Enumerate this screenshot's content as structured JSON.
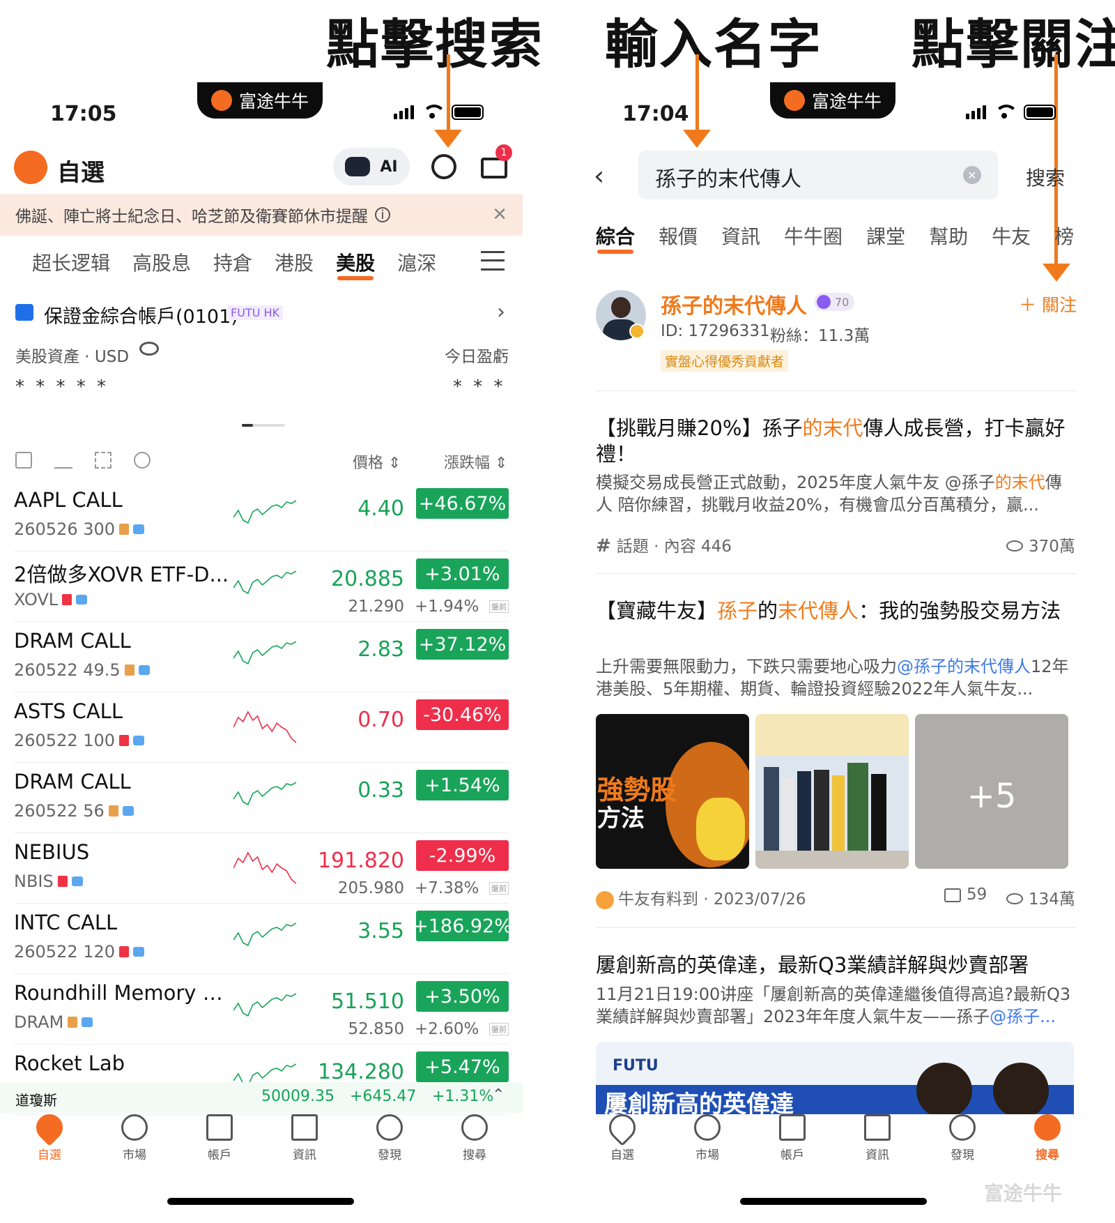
{
  "annotations": {
    "left_top": "點擊搜索",
    "right_middle": "輸入名字",
    "right_top": "點擊關注"
  },
  "left": {
    "pill": "富途牛牛",
    "time": "17:05",
    "title": "自選",
    "ai_label": "AI",
    "mail_badge": "1",
    "banner": "佛誕、陣亡將士紀念日、哈芝節及衛賽節休市提醒",
    "tabs": [
      "超长逻辑",
      "高股息",
      "持倉",
      "港股",
      "美股",
      "滬深"
    ],
    "active_tab": "美股",
    "account": {
      "name": "保證金綜合帳戶(0101)",
      "badge": "FUTU HK",
      "assets_label": "美股資產 · USD",
      "today_pl_label": "今日盈虧",
      "assets_masked": "* * * * *",
      "pl_masked": "* * *"
    },
    "columns": {
      "price": "價格",
      "change": "漲跌幅"
    },
    "stocks": [
      {
        "name": "AAPL CALL",
        "code": "260526 300",
        "price": "4.40",
        "change": "+46.67%",
        "dir": "up",
        "doc": "#e8a04a"
      },
      {
        "name": "2倍做多XOVR ETF-D...",
        "code": "XOVL",
        "price": "20.885",
        "change": "+3.01%",
        "dir": "up",
        "doc": "#ee3344",
        "pre_price": "21.290",
        "pre_change": "+1.94%",
        "pre_tag": "盤前"
      },
      {
        "name": "DRAM CALL",
        "code": "260522 49.5",
        "price": "2.83",
        "change": "+37.12%",
        "dir": "up",
        "doc": "#e8a04a"
      },
      {
        "name": "ASTS CALL",
        "code": "260522 100",
        "price": "0.70",
        "change": "-30.46%",
        "dir": "down",
        "doc": "#ee3344"
      },
      {
        "name": "DRAM CALL",
        "code": "260522 56",
        "price": "0.33",
        "change": "+1.54%",
        "dir": "up",
        "doc": "#e8a04a"
      },
      {
        "name": "NEBIUS",
        "code": "NBIS",
        "price": "191.820",
        "change": "-2.99%",
        "dir": "down",
        "doc": "#ee3344",
        "pre_price": "205.980",
        "pre_change": "+7.38%",
        "pre_tag": "盤前"
      },
      {
        "name": "INTC CALL",
        "code": "260522 120",
        "price": "3.55",
        "change": "+186.92%",
        "dir": "up",
        "doc": "#ee3344"
      },
      {
        "name": "Roundhill Memory ETF",
        "code": "DRAM",
        "price": "51.510",
        "change": "+3.50%",
        "dir": "up",
        "doc": "#e8a04a",
        "pre_price": "52.850",
        "pre_change": "+2.60%",
        "pre_tag": "盤前"
      },
      {
        "name": "Rocket Lab",
        "code": "",
        "price": "134.280",
        "change": "+5.47%",
        "dir": "up",
        "doc": ""
      }
    ],
    "index_bar": {
      "name": "道瓊斯",
      "value": "50009.35",
      "change": "+645.47",
      "percent": "+1.31%"
    },
    "nav": [
      "自選",
      "市場",
      "帳戶",
      "資訊",
      "發現",
      "搜尋"
    ],
    "nav_active": "自選"
  },
  "right": {
    "pill": "富途牛牛",
    "time": "17:04",
    "search_value": "孫子的末代傳人",
    "search_button": "搜索",
    "tabs": [
      "綜合",
      "報價",
      "資訊",
      "牛牛圈",
      "課堂",
      "幫助",
      "牛友",
      "榜"
    ],
    "active_tab": "綜合",
    "user": {
      "name": "孫子的末代傳人",
      "level": "70",
      "id_line": "ID: 17296331",
      "fans": "粉絲：11.3萬",
      "badge": "實盤心得優秀貢獻者",
      "follow": "＋ 關注"
    },
    "post1": {
      "title_a": "【挑戰月賺20%】孫子",
      "title_hl": "的末代",
      "title_b": "傳人成長營，打卡贏好禮！",
      "body_a": "模擬交易成長營正式啟動，2025年度人氣牛友 @孫子",
      "body_hl": "的末代",
      "body_b": "傳人 陪你練習，挑戰月收益20%，有機會瓜分百萬積分，贏...",
      "topic": "話題 · 內容 446",
      "views": "370萬"
    },
    "post2": {
      "title_a": "【寶藏牛友】",
      "title_hl1": "孫子",
      "title_mid": "的",
      "title_hl2": "末代傳人",
      "title_b": "：我的強勢股交易方法",
      "body_a": "上升需要無限動力，下跌只需要地心吸力",
      "body_link": "@孫子的末代傳人",
      "body_b": "12年港美股、5年期權、期貨、輪證投資經驗2022年人氣牛友...",
      "img1_text1": "強勢股",
      "img1_text2": "方法",
      "img3_more": "+5",
      "author": "牛友有料到 · 2023/07/26",
      "comments": "59",
      "views": "134萬"
    },
    "post3": {
      "title": "屢創新高的英偉達，最新Q3業績詳解與炒賣部署",
      "body_a": "11月21日19:00讲座「屢創新高的英偉達繼後值得高追?最新Q3業績詳解與炒賣部署」2023年年度人氣牛友——孫子",
      "body_link": "@孫子...",
      "banner_brand": "FUTU",
      "banner_text": "屢創新高的英偉達"
    },
    "nav": [
      "自選",
      "市場",
      "帳戶",
      "資訊",
      "發現",
      "搜尋"
    ],
    "nav_active": "搜尋",
    "watermark": "富途牛牛"
  },
  "colors": {
    "accent": "#f46b22",
    "up": "#19a45a",
    "down": "#ee2e4a",
    "annotation_arrow": "#f07a1a"
  }
}
